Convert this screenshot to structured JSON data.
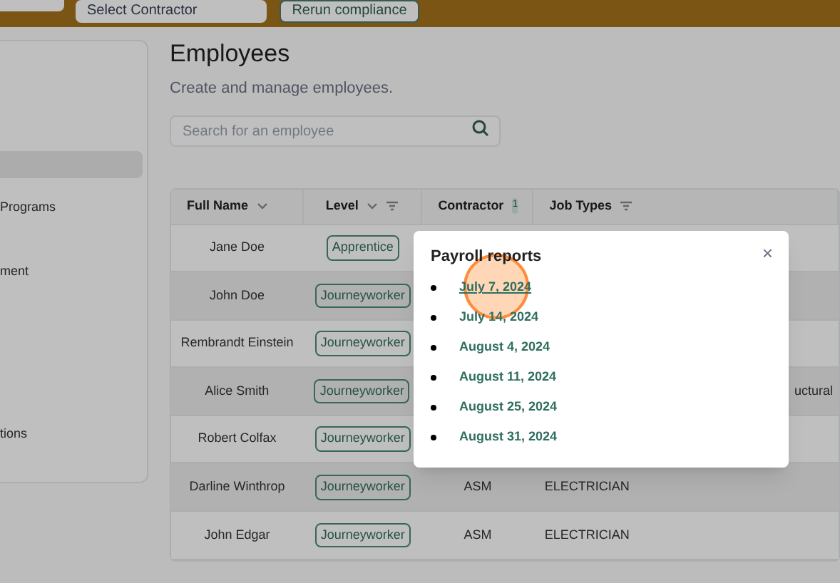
{
  "top_bar": {
    "dropdown": "Select Contractor",
    "button": "Rerun compliance"
  },
  "sidebar": {
    "items": [
      {
        "selected": true
      },
      {
        "label": "Programs",
        "selected": false
      },
      {
        "label": "ment",
        "selected": false
      },
      {
        "label": "tions",
        "selected": false
      }
    ]
  },
  "page": {
    "title": "Employees",
    "subtitle": "Create and manage employees.",
    "search": {
      "placeholder": "Search for an employee"
    }
  },
  "table": {
    "columns": [
      {
        "label": "Full Name",
        "sort": true,
        "filter": false
      },
      {
        "label": "Level",
        "sort": true,
        "filter": true
      },
      {
        "label": "Contractor",
        "sort": false,
        "filter": false,
        "count": "1"
      },
      {
        "label": "Job Types",
        "sort": false,
        "filter": true
      }
    ],
    "rows": [
      {
        "name": "Jane Doe",
        "level": "Apprentice",
        "contractor": "",
        "job_type": ""
      },
      {
        "name": "John Doe",
        "level": "Journeyworker",
        "contractor": "",
        "job_type": ""
      },
      {
        "name": "Rembrandt Einstein",
        "level": "Journeyworker",
        "contractor": "",
        "job_type": ""
      },
      {
        "name": "Alice Smith",
        "level": "Journeyworker",
        "contractor": "",
        "job_type": "uctural"
      },
      {
        "name": "Robert Colfax",
        "level": "Journeyworker",
        "contractor": "",
        "job_type": ""
      },
      {
        "name": "Darline Winthrop",
        "level": "Journeyworker",
        "contractor": "ASM",
        "job_type": "ELECTRICIAN"
      },
      {
        "name": "John Edgar",
        "level": "Journeyworker",
        "contractor": "ASM",
        "job_type": "ELECTRICIAN"
      }
    ]
  },
  "modal": {
    "title": "Payroll reports",
    "close": "×",
    "links": [
      {
        "label": "July 7, 2024",
        "hovered": true
      },
      {
        "label": "July 14, 2024",
        "hovered": false
      },
      {
        "label": "August 4, 2024",
        "hovered": false
      },
      {
        "label": "August 11, 2024",
        "hovered": false
      },
      {
        "label": "August 25, 2024",
        "hovered": false
      },
      {
        "label": "August 31, 2024",
        "hovered": false
      }
    ]
  }
}
